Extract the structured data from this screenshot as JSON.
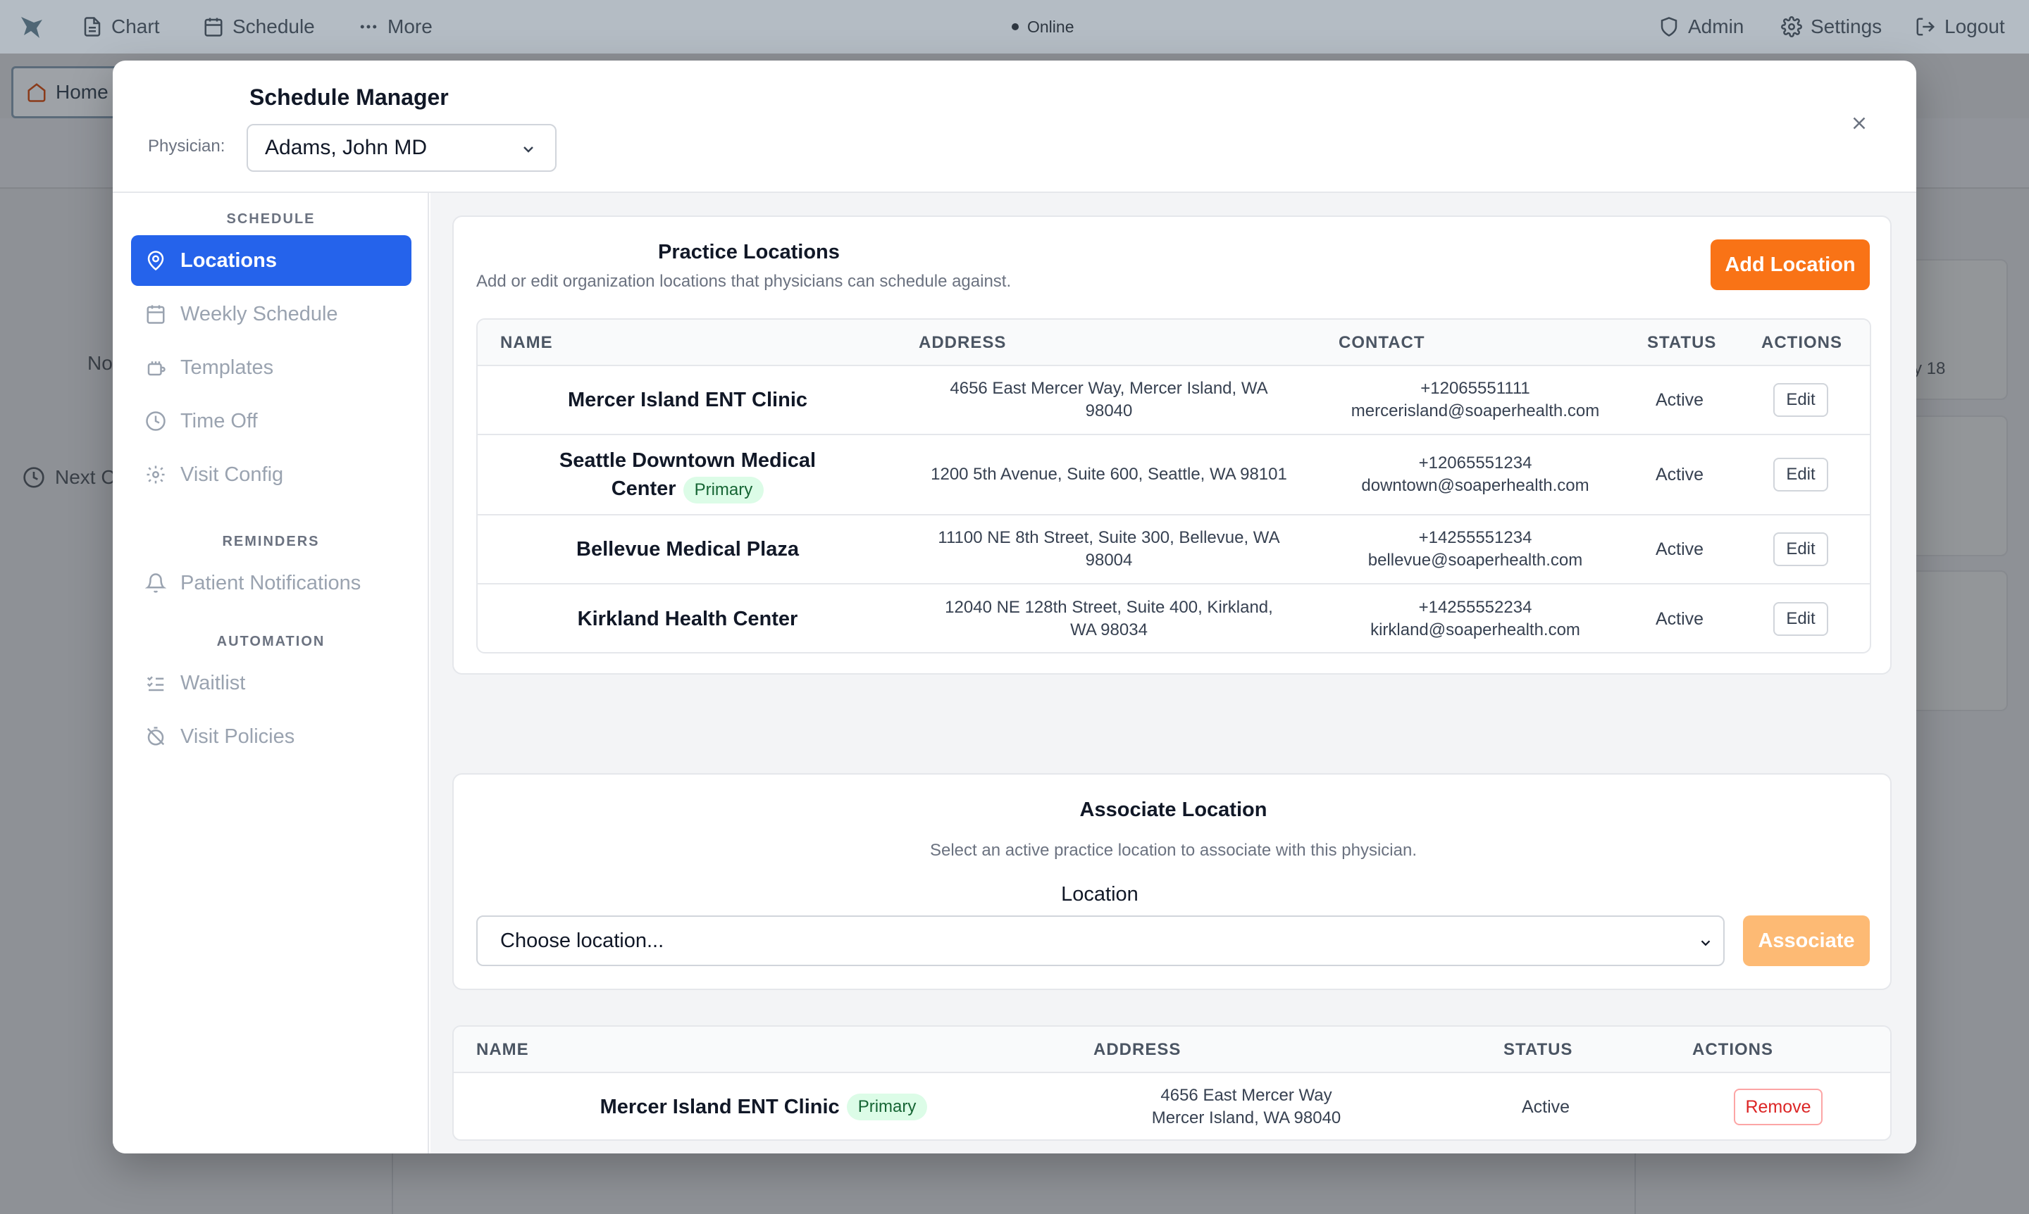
{
  "topbar": {
    "chart": "Chart",
    "schedule": "Schedule",
    "more": "More",
    "status": "Online",
    "admin": "Admin",
    "settings": "Settings",
    "logout": "Logout"
  },
  "background": {
    "tab_home": "Home",
    "fragment_no": "No",
    "fragment_next": "Next C",
    "fragment_date": "y 18"
  },
  "modal": {
    "title": "Schedule Manager",
    "physician_label": "Physician:",
    "physician_value": "Adams, John MD"
  },
  "sidebar": {
    "sections": [
      {
        "label": "SCHEDULE"
      },
      {
        "label": "REMINDERS"
      },
      {
        "label": "AUTOMATION"
      }
    ],
    "items": [
      {
        "label": "Locations",
        "icon": "map-pin-icon",
        "active": true
      },
      {
        "label": "Weekly Schedule",
        "icon": "calendar-icon"
      },
      {
        "label": "Templates",
        "icon": "template-icon"
      },
      {
        "label": "Time Off",
        "icon": "clock-icon"
      },
      {
        "label": "Visit Config",
        "icon": "gear-icon"
      },
      {
        "label": "Patient Notifications",
        "icon": "bell-icon"
      },
      {
        "label": "Waitlist",
        "icon": "list-checks-icon"
      },
      {
        "label": "Visit Policies",
        "icon": "timer-off-icon"
      }
    ]
  },
  "practice_locations": {
    "title": "Practice Locations",
    "subtitle": "Add or edit organization locations that physicians can schedule against.",
    "add_button": "Add Location",
    "columns": [
      "NAME",
      "ADDRESS",
      "CONTACT",
      "STATUS",
      "ACTIONS"
    ],
    "rows": [
      {
        "name": "Mercer Island ENT Clinic",
        "badge": "",
        "address_1": "4656 East Mercer Way, Mercer Island, WA",
        "address_2": "98040",
        "phone": "+12065551111",
        "email": "mercerisland@soaperhealth.com",
        "status": "Active",
        "action": "Edit"
      },
      {
        "name": "Seattle Downtown Medical",
        "name_2": "Center",
        "badge": "Primary",
        "address_1": "1200 5th Avenue, Suite 600, Seattle, WA 98101",
        "address_2": "",
        "phone": "+12065551234",
        "email": "downtown@soaperhealth.com",
        "status": "Active",
        "action": "Edit"
      },
      {
        "name": "Bellevue Medical Plaza",
        "badge": "",
        "address_1": "11100 NE 8th Street, Suite 300, Bellevue, WA",
        "address_2": "98004",
        "phone": "+14255551234",
        "email": "bellevue@soaperhealth.com",
        "status": "Active",
        "action": "Edit"
      },
      {
        "name": "Kirkland Health Center",
        "badge": "",
        "address_1": "12040 NE 128th Street, Suite 400, Kirkland,",
        "address_2": "WA 98034",
        "phone": "+14255552234",
        "email": "kirkland@soaperhealth.com",
        "status": "Active",
        "action": "Edit"
      }
    ]
  },
  "associate": {
    "title": "Associate Location",
    "subtitle": "Select an active practice location to associate with this physician.",
    "location_label": "Location",
    "select_value": "Choose location...",
    "button": "Associate"
  },
  "associated": {
    "columns": [
      "NAME",
      "ADDRESS",
      "STATUS",
      "ACTIONS"
    ],
    "rows": [
      {
        "name": "Mercer Island ENT Clinic",
        "badge": "Primary",
        "address_1": "4656 East Mercer Way",
        "address_2": "Mercer Island, WA 98040",
        "status": "Active",
        "action": "Remove"
      }
    ]
  },
  "colors": {
    "accent_blue": "#2563eb",
    "accent_orange": "#f97316",
    "badge_green_bg": "#dcfce7",
    "danger_red": "#dc2626"
  }
}
